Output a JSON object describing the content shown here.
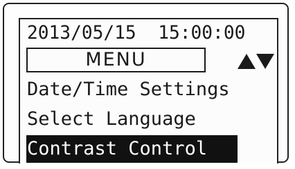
{
  "display": {
    "date": "2013/05/15",
    "time": "15:00:00",
    "datetime_line": "2013/05/15  15:00:00",
    "menu_title": "MENU",
    "nav_icons": [
      "arrow-up-icon",
      "arrow-down-icon"
    ],
    "menu_items": [
      {
        "label": "Date/Time Settings",
        "selected": false
      },
      {
        "label": "Select Language",
        "selected": false
      },
      {
        "label": "Contrast Control",
        "selected": true
      }
    ]
  },
  "colors": {
    "background": "#fefefe",
    "text": "#1a1a1a",
    "highlight_bg": "#111111",
    "highlight_text": "#ffffff"
  }
}
